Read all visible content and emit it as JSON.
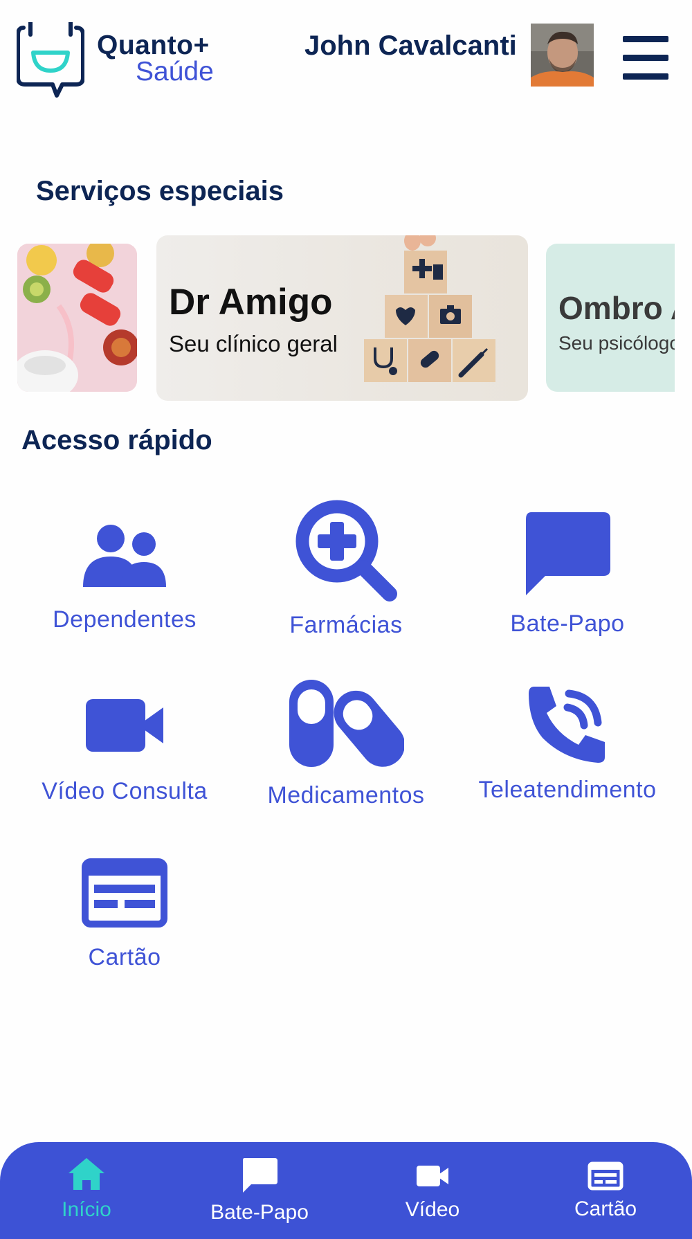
{
  "header": {
    "logo_line1": "Quanto+",
    "logo_line2": "Saúde",
    "user_name": "John Cavalcanti"
  },
  "special_services": {
    "title": "Serviços especiais",
    "cards": [
      {
        "title": "",
        "subtitle": ""
      },
      {
        "title": "Dr Amigo",
        "subtitle": "Seu clínico geral"
      },
      {
        "title": "Ombro Amigo",
        "subtitle": "Seu psicólogo"
      }
    ]
  },
  "quick_access": {
    "title": "Acesso rápido",
    "items": [
      {
        "label": "Dependentes",
        "icon": "users-icon"
      },
      {
        "label": "Farmácias",
        "icon": "search-plus-icon"
      },
      {
        "label": "Bate-Papo",
        "icon": "chat-bubble-icon"
      },
      {
        "label": "Vídeo Consulta",
        "icon": "video-camera-icon"
      },
      {
        "label": "Medicamentos",
        "icon": "pills-icon"
      },
      {
        "label": "Teleatendimento",
        "icon": "phone-icon"
      },
      {
        "label": "Cartão",
        "icon": "card-icon"
      }
    ]
  },
  "bottom_nav": {
    "items": [
      {
        "label": "Início",
        "icon": "home-icon",
        "active": true
      },
      {
        "label": "Bate-Papo",
        "icon": "chat-bubble-icon",
        "active": false
      },
      {
        "label": "Vídeo",
        "icon": "video-camera-icon",
        "active": false
      },
      {
        "label": "Cartão",
        "icon": "card-icon",
        "active": false
      }
    ]
  },
  "colors": {
    "primary": "#3f53d6",
    "navy": "#0d2554",
    "accent": "#2fd3c9",
    "nav_bg": "#3d52d5"
  }
}
